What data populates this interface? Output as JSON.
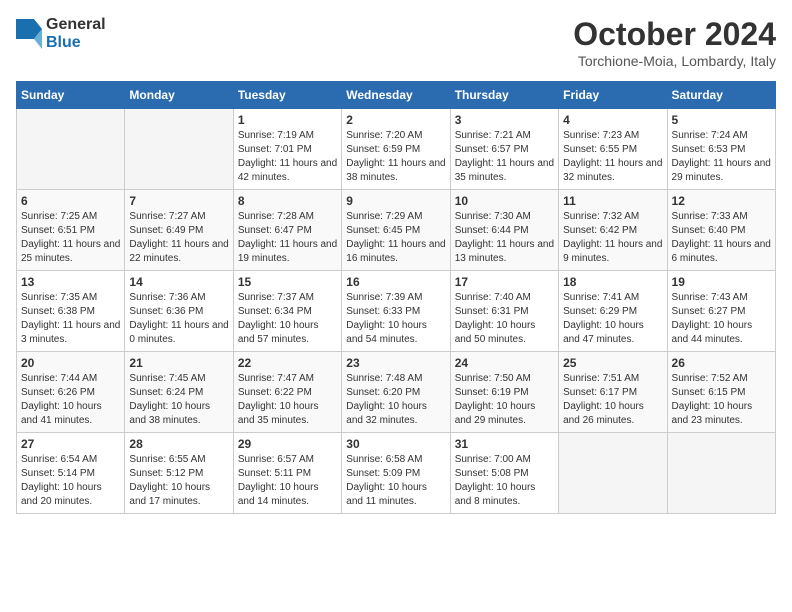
{
  "header": {
    "logo_general": "General",
    "logo_blue": "Blue",
    "month_title": "October 2024",
    "location": "Torchione-Moia, Lombardy, Italy"
  },
  "weekdays": [
    "Sunday",
    "Monday",
    "Tuesday",
    "Wednesday",
    "Thursday",
    "Friday",
    "Saturday"
  ],
  "weeks": [
    [
      {
        "day": "",
        "sunrise": "",
        "sunset": "",
        "daylight": ""
      },
      {
        "day": "",
        "sunrise": "",
        "sunset": "",
        "daylight": ""
      },
      {
        "day": "1",
        "sunrise": "Sunrise: 7:19 AM",
        "sunset": "Sunset: 7:01 PM",
        "daylight": "Daylight: 11 hours and 42 minutes."
      },
      {
        "day": "2",
        "sunrise": "Sunrise: 7:20 AM",
        "sunset": "Sunset: 6:59 PM",
        "daylight": "Daylight: 11 hours and 38 minutes."
      },
      {
        "day": "3",
        "sunrise": "Sunrise: 7:21 AM",
        "sunset": "Sunset: 6:57 PM",
        "daylight": "Daylight: 11 hours and 35 minutes."
      },
      {
        "day": "4",
        "sunrise": "Sunrise: 7:23 AM",
        "sunset": "Sunset: 6:55 PM",
        "daylight": "Daylight: 11 hours and 32 minutes."
      },
      {
        "day": "5",
        "sunrise": "Sunrise: 7:24 AM",
        "sunset": "Sunset: 6:53 PM",
        "daylight": "Daylight: 11 hours and 29 minutes."
      }
    ],
    [
      {
        "day": "6",
        "sunrise": "Sunrise: 7:25 AM",
        "sunset": "Sunset: 6:51 PM",
        "daylight": "Daylight: 11 hours and 25 minutes."
      },
      {
        "day": "7",
        "sunrise": "Sunrise: 7:27 AM",
        "sunset": "Sunset: 6:49 PM",
        "daylight": "Daylight: 11 hours and 22 minutes."
      },
      {
        "day": "8",
        "sunrise": "Sunrise: 7:28 AM",
        "sunset": "Sunset: 6:47 PM",
        "daylight": "Daylight: 11 hours and 19 minutes."
      },
      {
        "day": "9",
        "sunrise": "Sunrise: 7:29 AM",
        "sunset": "Sunset: 6:45 PM",
        "daylight": "Daylight: 11 hours and 16 minutes."
      },
      {
        "day": "10",
        "sunrise": "Sunrise: 7:30 AM",
        "sunset": "Sunset: 6:44 PM",
        "daylight": "Daylight: 11 hours and 13 minutes."
      },
      {
        "day": "11",
        "sunrise": "Sunrise: 7:32 AM",
        "sunset": "Sunset: 6:42 PM",
        "daylight": "Daylight: 11 hours and 9 minutes."
      },
      {
        "day": "12",
        "sunrise": "Sunrise: 7:33 AM",
        "sunset": "Sunset: 6:40 PM",
        "daylight": "Daylight: 11 hours and 6 minutes."
      }
    ],
    [
      {
        "day": "13",
        "sunrise": "Sunrise: 7:35 AM",
        "sunset": "Sunset: 6:38 PM",
        "daylight": "Daylight: 11 hours and 3 minutes."
      },
      {
        "day": "14",
        "sunrise": "Sunrise: 7:36 AM",
        "sunset": "Sunset: 6:36 PM",
        "daylight": "Daylight: 11 hours and 0 minutes."
      },
      {
        "day": "15",
        "sunrise": "Sunrise: 7:37 AM",
        "sunset": "Sunset: 6:34 PM",
        "daylight": "Daylight: 10 hours and 57 minutes."
      },
      {
        "day": "16",
        "sunrise": "Sunrise: 7:39 AM",
        "sunset": "Sunset: 6:33 PM",
        "daylight": "Daylight: 10 hours and 54 minutes."
      },
      {
        "day": "17",
        "sunrise": "Sunrise: 7:40 AM",
        "sunset": "Sunset: 6:31 PM",
        "daylight": "Daylight: 10 hours and 50 minutes."
      },
      {
        "day": "18",
        "sunrise": "Sunrise: 7:41 AM",
        "sunset": "Sunset: 6:29 PM",
        "daylight": "Daylight: 10 hours and 47 minutes."
      },
      {
        "day": "19",
        "sunrise": "Sunrise: 7:43 AM",
        "sunset": "Sunset: 6:27 PM",
        "daylight": "Daylight: 10 hours and 44 minutes."
      }
    ],
    [
      {
        "day": "20",
        "sunrise": "Sunrise: 7:44 AM",
        "sunset": "Sunset: 6:26 PM",
        "daylight": "Daylight: 10 hours and 41 minutes."
      },
      {
        "day": "21",
        "sunrise": "Sunrise: 7:45 AM",
        "sunset": "Sunset: 6:24 PM",
        "daylight": "Daylight: 10 hours and 38 minutes."
      },
      {
        "day": "22",
        "sunrise": "Sunrise: 7:47 AM",
        "sunset": "Sunset: 6:22 PM",
        "daylight": "Daylight: 10 hours and 35 minutes."
      },
      {
        "day": "23",
        "sunrise": "Sunrise: 7:48 AM",
        "sunset": "Sunset: 6:20 PM",
        "daylight": "Daylight: 10 hours and 32 minutes."
      },
      {
        "day": "24",
        "sunrise": "Sunrise: 7:50 AM",
        "sunset": "Sunset: 6:19 PM",
        "daylight": "Daylight: 10 hours and 29 minutes."
      },
      {
        "day": "25",
        "sunrise": "Sunrise: 7:51 AM",
        "sunset": "Sunset: 6:17 PM",
        "daylight": "Daylight: 10 hours and 26 minutes."
      },
      {
        "day": "26",
        "sunrise": "Sunrise: 7:52 AM",
        "sunset": "Sunset: 6:15 PM",
        "daylight": "Daylight: 10 hours and 23 minutes."
      }
    ],
    [
      {
        "day": "27",
        "sunrise": "Sunrise: 6:54 AM",
        "sunset": "Sunset: 5:14 PM",
        "daylight": "Daylight: 10 hours and 20 minutes."
      },
      {
        "day": "28",
        "sunrise": "Sunrise: 6:55 AM",
        "sunset": "Sunset: 5:12 PM",
        "daylight": "Daylight: 10 hours and 17 minutes."
      },
      {
        "day": "29",
        "sunrise": "Sunrise: 6:57 AM",
        "sunset": "Sunset: 5:11 PM",
        "daylight": "Daylight: 10 hours and 14 minutes."
      },
      {
        "day": "30",
        "sunrise": "Sunrise: 6:58 AM",
        "sunset": "Sunset: 5:09 PM",
        "daylight": "Daylight: 10 hours and 11 minutes."
      },
      {
        "day": "31",
        "sunrise": "Sunrise: 7:00 AM",
        "sunset": "Sunset: 5:08 PM",
        "daylight": "Daylight: 10 hours and 8 minutes."
      },
      {
        "day": "",
        "sunrise": "",
        "sunset": "",
        "daylight": ""
      },
      {
        "day": "",
        "sunrise": "",
        "sunset": "",
        "daylight": ""
      }
    ]
  ]
}
